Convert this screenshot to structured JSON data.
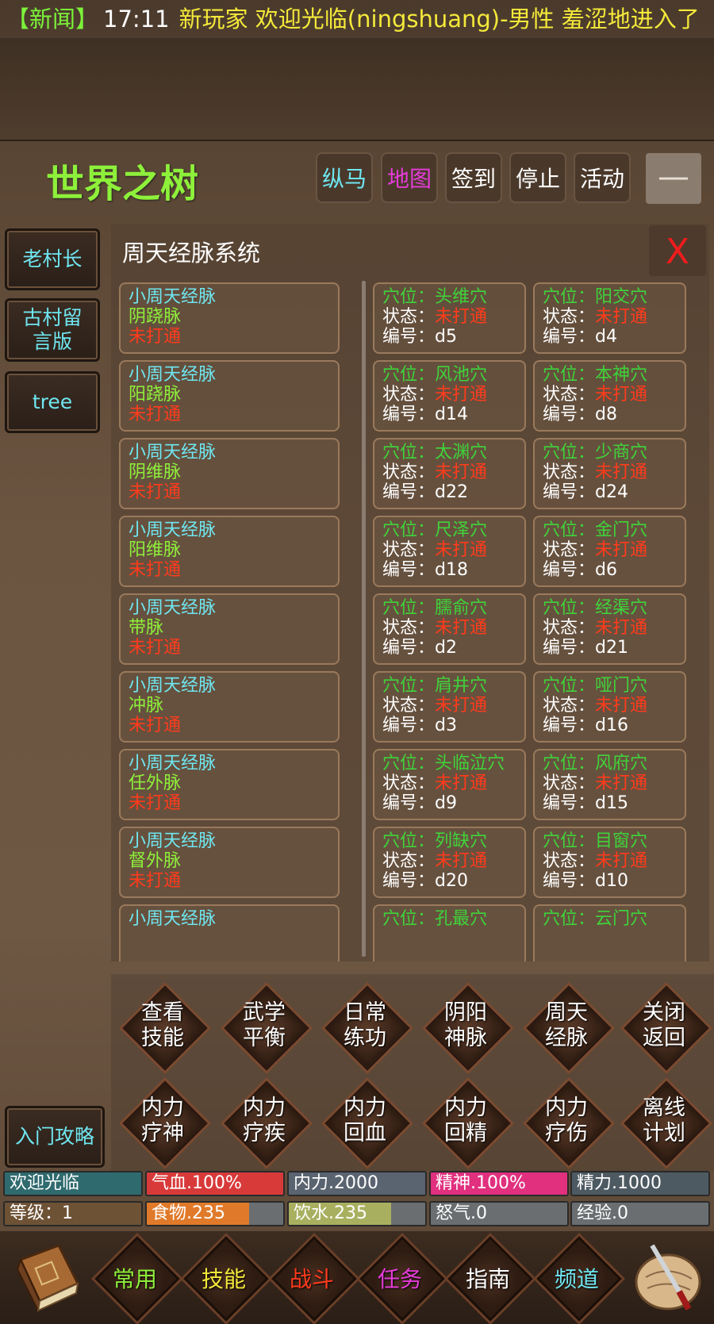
{
  "news": {
    "tag": "【新闻】",
    "time": "17:11",
    "message": "新玩家 欢迎光临(ningshuang)-男性 羞涩地进入了"
  },
  "header": {
    "title": "世界之树",
    "buttons": [
      {
        "label": "纵马",
        "color": "#6fe6f0"
      },
      {
        "label": "地图",
        "color": "#e53cd8"
      },
      {
        "label": "签到",
        "color": "#ffffff"
      },
      {
        "label": "停止",
        "color": "#ffffff"
      },
      {
        "label": "活动",
        "color": "#ffffff"
      }
    ],
    "minimize": "—"
  },
  "sidebar": {
    "items": [
      "老村长",
      "古村留言版",
      "tree"
    ],
    "guide": "入门攻略"
  },
  "panel": {
    "title": "周天经脉系统",
    "close": "X",
    "meridians": [
      {
        "group": "小周天经脉",
        "name": "阴跷脉",
        "status": "未打通"
      },
      {
        "group": "小周天经脉",
        "name": "阳跷脉",
        "status": "未打通"
      },
      {
        "group": "小周天经脉",
        "name": "阴维脉",
        "status": "未打通"
      },
      {
        "group": "小周天经脉",
        "name": "阳维脉",
        "status": "未打通"
      },
      {
        "group": "小周天经脉",
        "name": "带脉",
        "status": "未打通"
      },
      {
        "group": "小周天经脉",
        "name": "冲脉",
        "status": "未打通"
      },
      {
        "group": "小周天经脉",
        "name": "任外脉",
        "status": "未打通"
      },
      {
        "group": "小周天经脉",
        "name": "督外脉",
        "status": "未打通"
      },
      {
        "group": "小周天经脉",
        "name": "",
        "status": ""
      }
    ],
    "acupoints_col1": [
      {
        "point": "穴位：头维穴",
        "status_label": "状态：",
        "status": "未打通",
        "code": "编号：d5"
      },
      {
        "point": "穴位：风池穴",
        "status_label": "状态：",
        "status": "未打通",
        "code": "编号：d14"
      },
      {
        "point": "穴位：太渊穴",
        "status_label": "状态：",
        "status": "未打通",
        "code": "编号：d22"
      },
      {
        "point": "穴位：尺泽穴",
        "status_label": "状态：",
        "status": "未打通",
        "code": "编号：d18"
      },
      {
        "point": "穴位：臑俞穴",
        "status_label": "状态：",
        "status": "未打通",
        "code": "编号：d2"
      },
      {
        "point": "穴位：肩井穴",
        "status_label": "状态：",
        "status": "未打通",
        "code": "编号：d3"
      },
      {
        "point": "穴位：头临泣穴",
        "status_label": "状态：",
        "status": "未打通",
        "code": "编号：d9"
      },
      {
        "point": "穴位：列缺穴",
        "status_label": "状态：",
        "status": "未打通",
        "code": "编号：d20"
      },
      {
        "point": "穴位：孔最穴",
        "status_label": "",
        "status": "",
        "code": ""
      }
    ],
    "acupoints_col2": [
      {
        "point": "穴位：阳交穴",
        "status_label": "状态：",
        "status": "未打通",
        "code": "编号：d4"
      },
      {
        "point": "穴位：本神穴",
        "status_label": "状态：",
        "status": "未打通",
        "code": "编号：d8"
      },
      {
        "point": "穴位：少商穴",
        "status_label": "状态：",
        "status": "未打通",
        "code": "编号：d24"
      },
      {
        "point": "穴位：金门穴",
        "status_label": "状态：",
        "status": "未打通",
        "code": "编号：d6"
      },
      {
        "point": "穴位：经渠穴",
        "status_label": "状态：",
        "status": "未打通",
        "code": "编号：d21"
      },
      {
        "point": "穴位：哑门穴",
        "status_label": "状态：",
        "status": "未打通",
        "code": "编号：d16"
      },
      {
        "point": "穴位：风府穴",
        "status_label": "状态：",
        "status": "未打通",
        "code": "编号：d15"
      },
      {
        "point": "穴位：目窗穴",
        "status_label": "状态：",
        "status": "未打通",
        "code": "编号：d10"
      },
      {
        "point": "穴位：云门穴",
        "status_label": "",
        "status": "",
        "code": ""
      }
    ]
  },
  "actions": {
    "row1": [
      [
        "查看",
        "技能"
      ],
      [
        "武学",
        "平衡"
      ],
      [
        "日常",
        "练功"
      ],
      [
        "阴阳",
        "神脉"
      ],
      [
        "周天",
        "经脉"
      ],
      [
        "关闭",
        "返回"
      ]
    ],
    "row2": [
      [
        "内力",
        "疗神"
      ],
      [
        "内力",
        "疗疾"
      ],
      [
        "内力",
        "回血"
      ],
      [
        "内力",
        "回精"
      ],
      [
        "内力",
        "疗伤"
      ],
      [
        "离线",
        "计划"
      ]
    ]
  },
  "stats": {
    "row1": [
      {
        "text": "欢迎光临",
        "fill": 1.0,
        "color": "#2f6a6e"
      },
      {
        "text": "气血.100%",
        "fill": 1.0,
        "color": "#d83a3a"
      },
      {
        "text": "内力.2000",
        "fill": 1.0,
        "color": "#5a6470"
      },
      {
        "text": "精神.100%",
        "fill": 1.0,
        "color": "#e0307e"
      },
      {
        "text": "精力.1000",
        "fill": 1.0,
        "color": "#4e5a62"
      }
    ],
    "row2": [
      {
        "text": "等级：1",
        "fill": 1.0,
        "color": "#6e5236"
      },
      {
        "text": "食物.235",
        "fill": 0.75,
        "color": "#e07a2a"
      },
      {
        "text": "饮水.235",
        "fill": 0.75,
        "color": "#a8b060"
      },
      {
        "text": "怒气.0",
        "fill": 0.0,
        "color": "#6a6e70"
      },
      {
        "text": "经验.0",
        "fill": 0.0,
        "color": "#4e5a62"
      }
    ]
  },
  "nav": {
    "items": [
      {
        "label": "常用",
        "color": "#8ef03a"
      },
      {
        "label": "技能",
        "color": "#f4e93a"
      },
      {
        "label": "战斗",
        "color": "#ff3b1c"
      },
      {
        "label": "任务",
        "color": "#e53cd8"
      },
      {
        "label": "指南",
        "color": "#ffffff"
      },
      {
        "label": "频道",
        "color": "#6fe6f0"
      }
    ]
  }
}
